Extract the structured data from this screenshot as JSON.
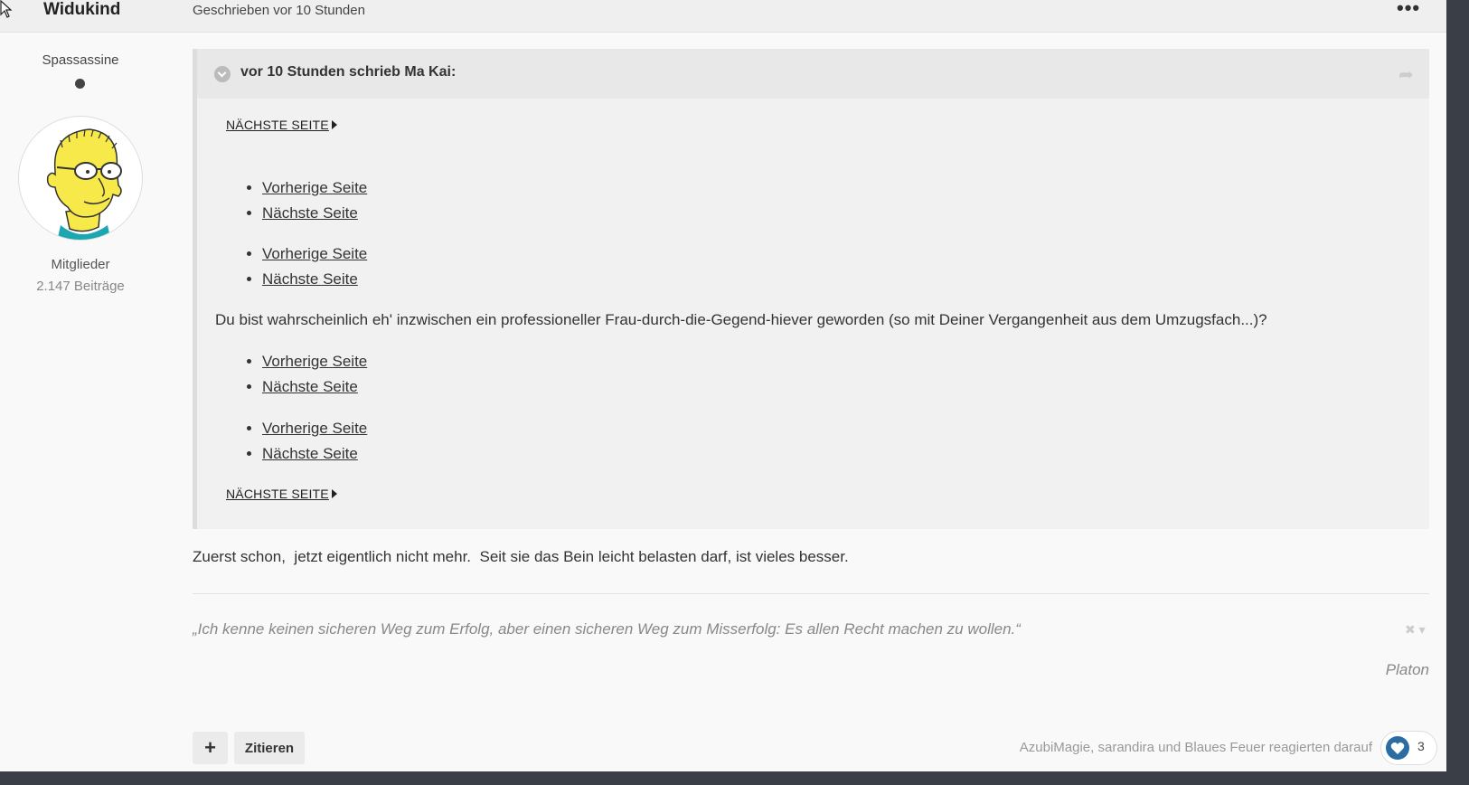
{
  "header": {
    "author_name": "Widukind",
    "post_date": "Geschrieben vor 10 Stunden"
  },
  "author": {
    "title": "Spassassine",
    "group": "Mitglieder",
    "post_count": "2.147 Beiträge"
  },
  "quote": {
    "citation": "vor 10 Stunden schrieb Ma Kai:",
    "next_page_top": "NÄCHSTE SEITE",
    "lists": [
      [
        "Vorherige Seite",
        "Nächste Seite"
      ],
      [
        "Vorherige Seite",
        "Nächste Seite"
      ],
      [
        "Vorherige Seite",
        "Nächste Seite"
      ],
      [
        "Vorherige Seite",
        "Nächste Seite"
      ]
    ],
    "text": "Du bist wahrscheinlich eh' inzwischen ein professioneller Frau-durch-die-Gegend-hiever geworden (so mit Deiner Vergangenheit aus dem Umzugsfach...)?",
    "next_page_bottom": "NÄCHSTE SEITE"
  },
  "reply": {
    "text": "Zuerst schon,  jetzt eigentlich nicht mehr.  Seit sie das Bein leicht belasten darf, ist vieles besser."
  },
  "signature": {
    "quote": "„Ich kenne keinen sicheren Weg zum Erfolg, aber einen sicheren Weg zum Misserfolg: Es allen Recht machen zu wollen.“",
    "author": "Platon"
  },
  "footer": {
    "add_label": "+",
    "quote_label": "Zitieren",
    "reactions_text": "AzubiMagie, sarandira und Blaues Feuer reagierten darauf",
    "reaction_count": "3"
  },
  "colors": {
    "accent": "#2b6ca3",
    "frame": "#3a3f47"
  },
  "icons": [
    "cursor-icon",
    "more-menu-icon",
    "online-status-icon",
    "chevron-down-icon",
    "share-icon",
    "close-icon",
    "heart-icon"
  ]
}
